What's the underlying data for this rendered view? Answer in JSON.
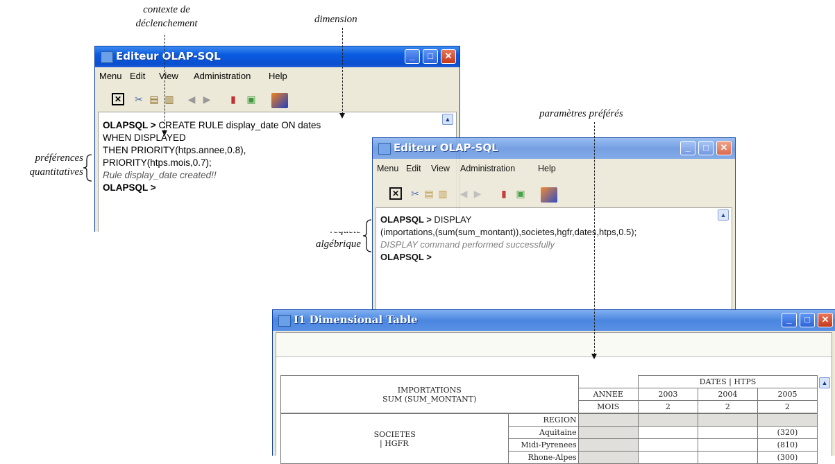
{
  "annotations": {
    "context": [
      "contexte de",
      "déclenchement"
    ],
    "dimension": "dimension",
    "preferences": [
      "préférences",
      "quantitatives"
    ],
    "params": "paramètres préférés",
    "query": [
      "requête",
      "algébrique"
    ]
  },
  "window1": {
    "title": "Editeur OLAP-SQL",
    "menu": [
      "Menu",
      "Edit",
      "View",
      "Administration",
      "Help"
    ],
    "lines": {
      "prompt1": "OLAPSQL >",
      "cmd1": " CREATE RULE display_date  ON dates",
      "l2": "WHEN DISPLAYED",
      "l3": "THEN PRIORITY(htps.annee,0.8),",
      "l4": "PRIORITY(htps.mois,0.7);",
      "l5": "Rule display_date created!!",
      "prompt2": "OLAPSQL >"
    }
  },
  "window2": {
    "title": "Editeur OLAP-SQL",
    "menu": [
      "Menu",
      "Edit",
      "View",
      "Administration",
      "Help"
    ],
    "lines": {
      "prompt1": "OLAPSQL >",
      "cmd1": " DISPLAY",
      "l2": "(importations,(sum(sum_montant)),societes,hgfr,dates,htps,0.5);",
      "l3": "DISPLAY command performed successfully",
      "prompt2": "OLAPSQL >"
    }
  },
  "window3": {
    "title": "I1 Dimensional Table",
    "measure": [
      "IMPORTATIONS",
      "SUM (SUM_MONTANT)"
    ],
    "col_dim": "DATES | HTPS",
    "annee_label": "ANNEE",
    "mois_label": "MOIS",
    "years": [
      "2003",
      "2004",
      "2005"
    ],
    "mois": [
      "2",
      "2",
      "2"
    ],
    "row_dim": [
      "SOCIETES",
      "| HGFR"
    ],
    "region_label": "REGION",
    "regions": [
      "Aquitaine",
      "Midi-Pyrenees",
      "Rhone-Alpes"
    ],
    "values_2005": [
      "(320)",
      "(810)",
      "(300)"
    ]
  }
}
